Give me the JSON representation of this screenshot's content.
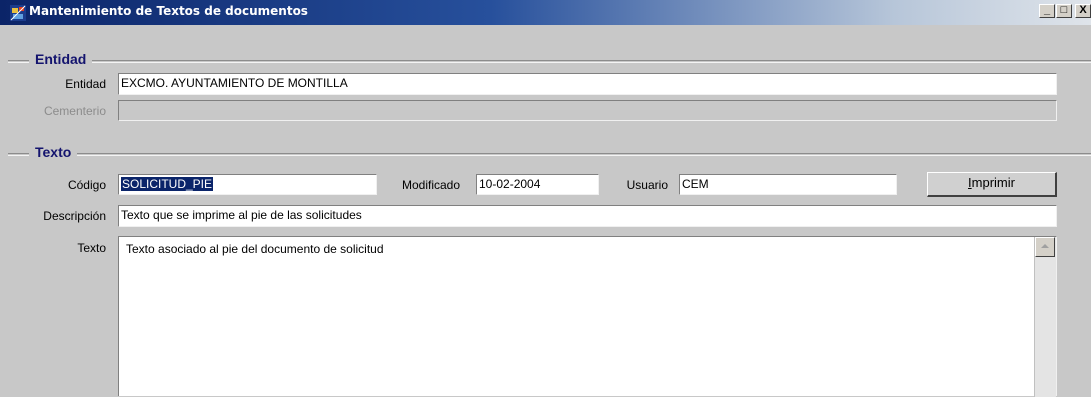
{
  "window": {
    "title": "Mantenimiento de Textos de documentos",
    "app_icon": "form-icon",
    "minimize_label": "_",
    "maximize_label": "□",
    "close_label": "X"
  },
  "entidad_group": {
    "title": "Entidad",
    "entidad_label": "Entidad",
    "entidad_value": "EXCMO. AYUNTAMIENTO DE MONTILLA",
    "cementerio_label": "Cementerio",
    "cementerio_value": ""
  },
  "texto_group": {
    "title": "Texto",
    "codigo_label": "Código",
    "codigo_value": "SOLICITUD_PIE",
    "modificado_label": "Modificado",
    "modificado_value": "10-02-2004",
    "usuario_label": "Usuario",
    "usuario_value": "CEM",
    "imprimir_mnemonic": "I",
    "imprimir_rest": "mprimir",
    "descripcion_label": "Descripción",
    "descripcion_value": "Texto que se imprime al pie de las solicitudes",
    "texto_label": "Texto",
    "texto_value": "Texto asociado al pie del documento de solicitud"
  },
  "colors": {
    "title_bar_start": "#0b2468",
    "group_title": "#14146e",
    "selection": "#0a246a",
    "background": "#c8c8c8"
  }
}
